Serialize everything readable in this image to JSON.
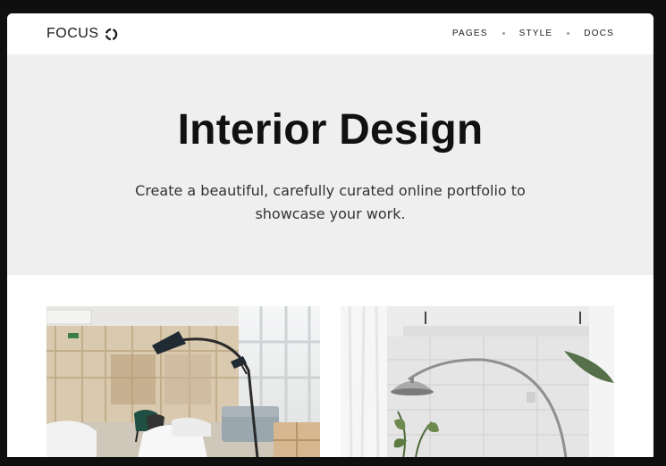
{
  "brand": {
    "name": "FOCUS",
    "logo_icon": "focus-ring-icon"
  },
  "nav": {
    "items": [
      {
        "label": "PAGES"
      },
      {
        "label": "STYLE"
      },
      {
        "label": "DOCS"
      }
    ]
  },
  "hero": {
    "title": "Interior Design",
    "subtitle_line1": "Create a beautiful, carefully curated online portfolio to",
    "subtitle_line2": "showcase your work."
  },
  "colors": {
    "page_bg": "#0f0f10",
    "window_bg": "#ffffff",
    "hero_bg": "#efefef",
    "text": "#111111"
  }
}
